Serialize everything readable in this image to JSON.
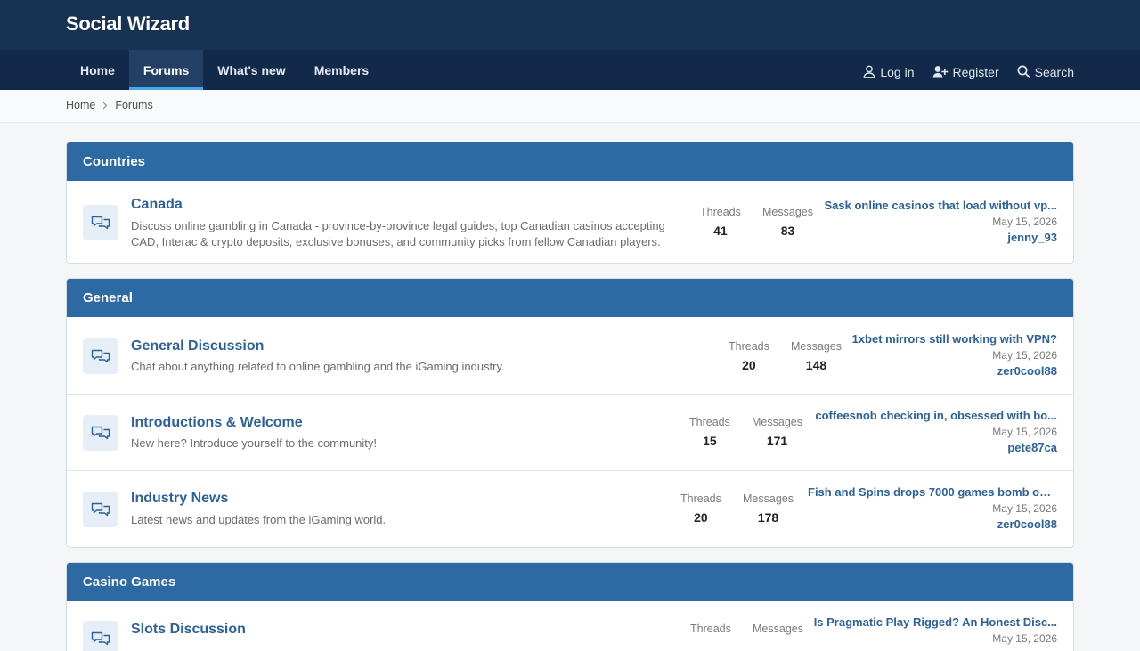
{
  "site": {
    "title": "Social Wizard"
  },
  "nav": {
    "tabs": [
      {
        "label": "Home"
      },
      {
        "label": "Forums",
        "active": true
      },
      {
        "label": "What's new"
      },
      {
        "label": "Members"
      }
    ],
    "actions": {
      "login": "Log in",
      "register": "Register",
      "search": "Search"
    }
  },
  "breadcrumb": [
    "Home",
    "Forums"
  ],
  "labels": {
    "threads": "Threads",
    "messages": "Messages"
  },
  "categories": [
    {
      "title": "Countries",
      "forums": [
        {
          "title": "Canada",
          "description": "Discuss online gambling in Canada - province-by-province legal guides, top Canadian casinos accepting CAD, Interac & crypto deposits, exclusive bonuses, and community picks from fellow Canadian players.",
          "threads": "41",
          "messages": "83",
          "last_title": "Sask online casinos that load without vp...",
          "last_date": "May 15, 2026",
          "last_user": "jenny_93"
        }
      ]
    },
    {
      "title": "General",
      "forums": [
        {
          "title": "General Discussion",
          "description": "Chat about anything related to online gambling and the iGaming industry.",
          "threads": "20",
          "messages": "148",
          "last_title": "1xbet mirrors still working with VPN?",
          "last_date": "May 15, 2026",
          "last_user": "zer0cool88"
        },
        {
          "title": "Introductions & Welcome",
          "description": "New here? Introduce yourself to the community!",
          "threads": "15",
          "messages": "171",
          "last_title": "coffeesnob checking in, obsessed with bo...",
          "last_date": "May 15, 2026",
          "last_user": "pete87ca"
        },
        {
          "title": "Industry News",
          "description": "Latest news and updates from the iGaming world.",
          "threads": "20",
          "messages": "178",
          "last_title": "Fish and Spins drops 7000 games bomb on ...",
          "last_date": "May 15, 2026",
          "last_user": "zer0cool88"
        }
      ]
    },
    {
      "title": "Casino Games",
      "forums": [
        {
          "title": "Slots Discussion",
          "threads_label_only": true,
          "last_title": "Is Pragmatic Play Rigged? An Honest Disc...",
          "last_date": "May 15, 2026"
        }
      ]
    }
  ],
  "colors": {
    "header": "#183254",
    "navbar": "#12294a",
    "category": "#2d6aa3",
    "link": "#2c6199",
    "active_tab_underline": "#47a7eb"
  },
  "icons": {
    "forum_node": "chat-bubbles-icon",
    "login": "user-icon",
    "register": "user-plus-icon",
    "search": "search-icon",
    "breadcrumb_sep": "chevron-right-icon"
  }
}
